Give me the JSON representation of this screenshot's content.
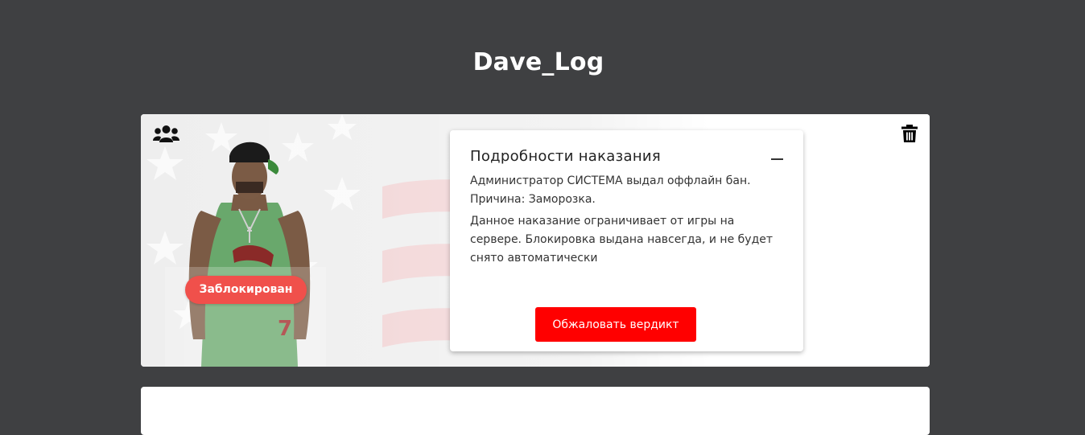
{
  "page": {
    "title": "Dave_Log"
  },
  "punishment_card": {
    "status_badge": "Заблокирован",
    "group_icon": "users-group-icon",
    "delete_icon": "trash-icon",
    "details": {
      "title": "Подробности наказания",
      "collapse_icon": "minus-icon",
      "line1": "Администратор СИСТЕМА выдал оффлайн бан.",
      "line2": "Причина: Заморозка.",
      "description": "Данное наказание ограничивает от игры на сервере. Блокировка выдана навсегда, и не будет снято автоматически",
      "appeal_button": "Обжаловать вердикт"
    }
  },
  "colors": {
    "page_background": "#3f4042",
    "badge": "#f0504b",
    "appeal_button": "#ff0000",
    "card": "#ffffff"
  }
}
